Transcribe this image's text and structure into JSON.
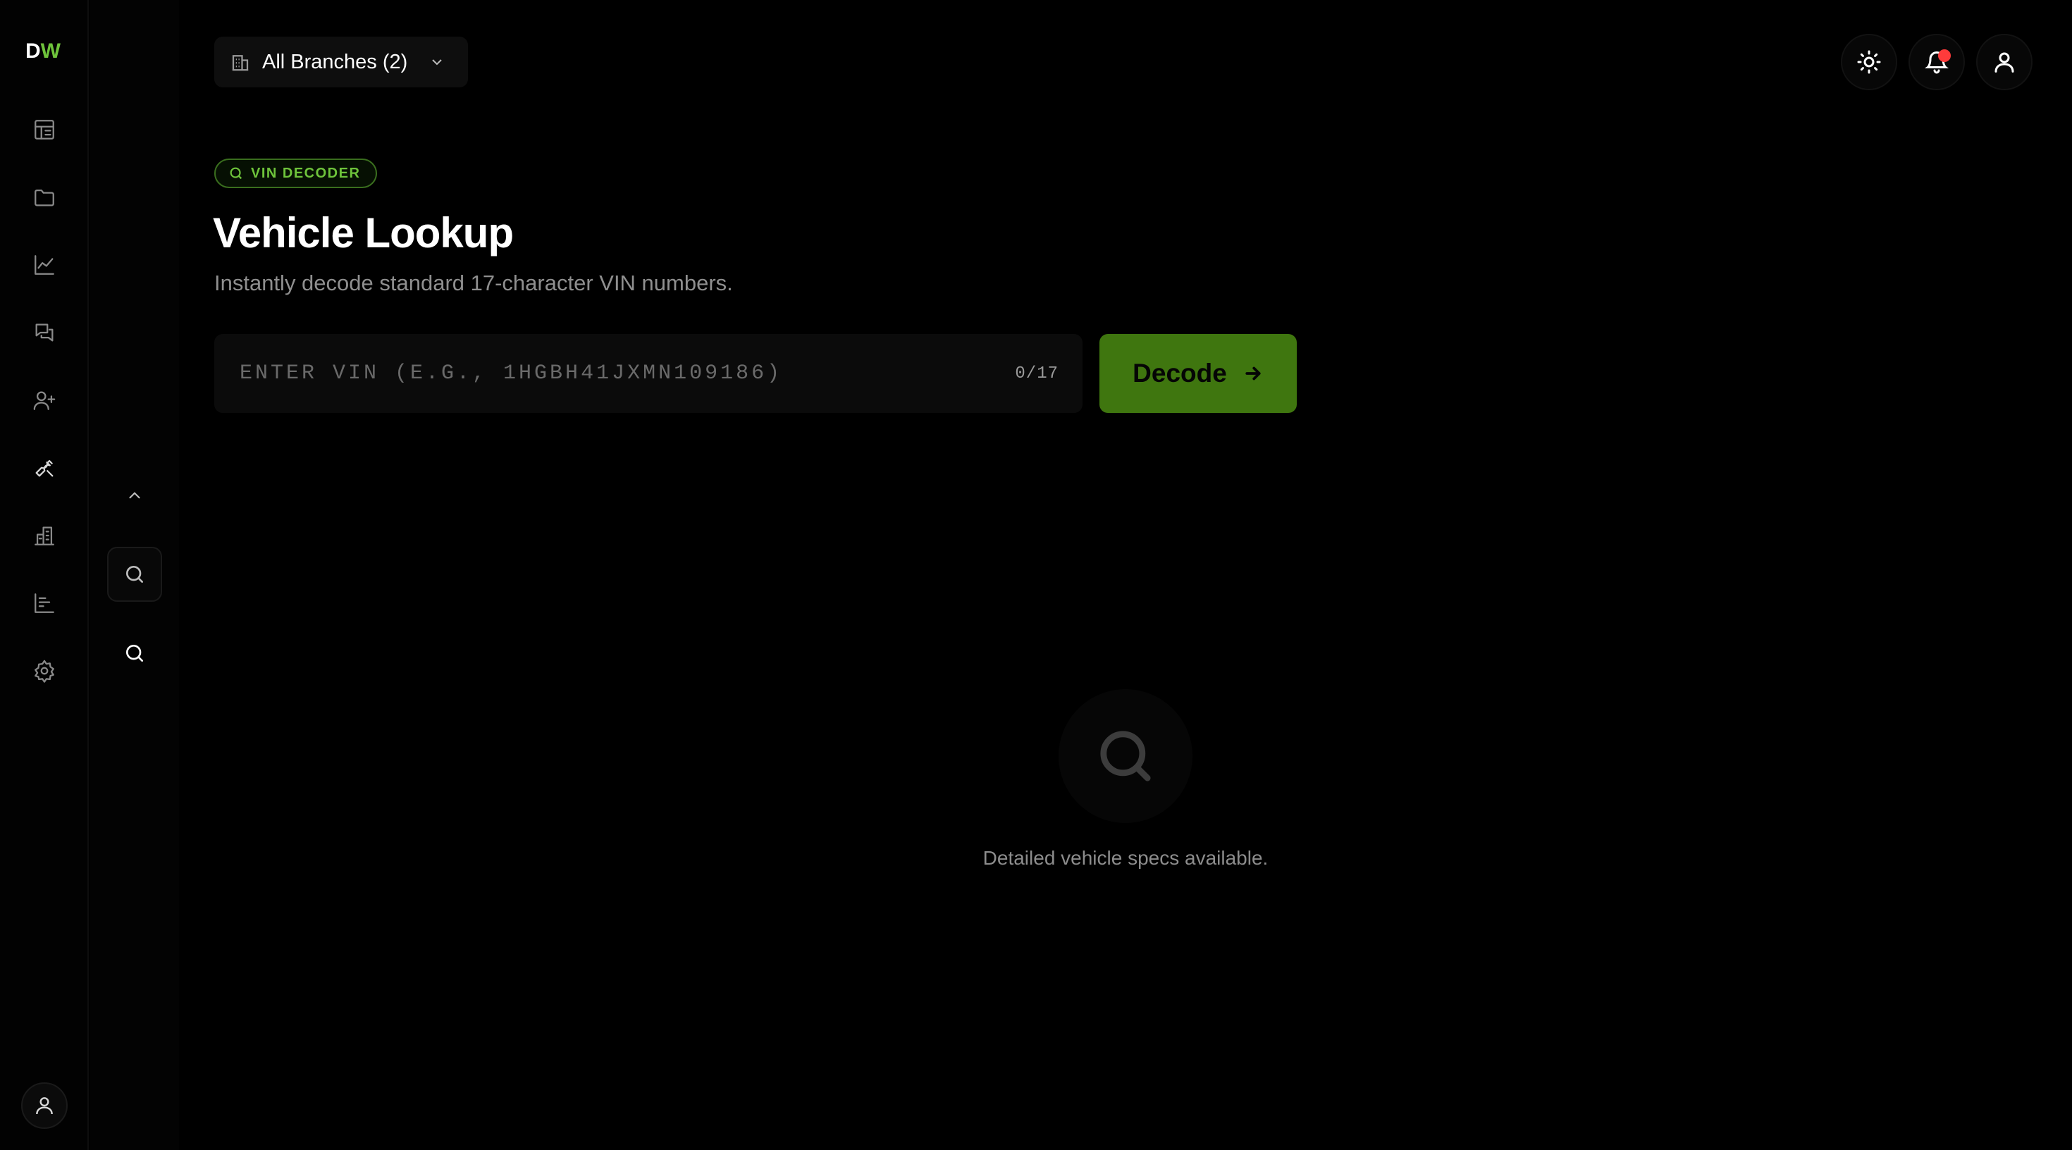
{
  "logo": {
    "d": "D",
    "w": "W"
  },
  "rail": {
    "items": [
      {
        "name": "dashboard-icon"
      },
      {
        "name": "folder-icon"
      },
      {
        "name": "analytics-icon"
      },
      {
        "name": "messages-icon"
      },
      {
        "name": "add-user-icon"
      },
      {
        "name": "tools-icon"
      },
      {
        "name": "buildings-icon"
      },
      {
        "name": "reports-icon"
      },
      {
        "name": "settings-icon"
      }
    ],
    "user_icon": "user-icon"
  },
  "panel": {
    "collapse_icon": "chevron-up-icon",
    "search_icons": [
      "search-icon",
      "search-icon"
    ]
  },
  "header": {
    "branch_label": "All Branches (2)",
    "branch_icon": "building-icon",
    "actions": [
      "sun-icon",
      "bell-icon",
      "user-icon"
    ],
    "notification_color": "#ff3b3b"
  },
  "main": {
    "badge": "VIN DECODER",
    "title": "Vehicle Lookup",
    "subtitle": "Instantly decode standard 17-character VIN numbers.",
    "vin_placeholder": "ENTER VIN (E.G., 1HGBH41JXMN109186)",
    "vin_value": "",
    "vin_counter": "0/17",
    "decode_label": "Decode",
    "empty_text": "Detailed vehicle specs available."
  },
  "colors": {
    "accent": "#6ec33b",
    "button": "#3f760f",
    "background": "#000000"
  }
}
